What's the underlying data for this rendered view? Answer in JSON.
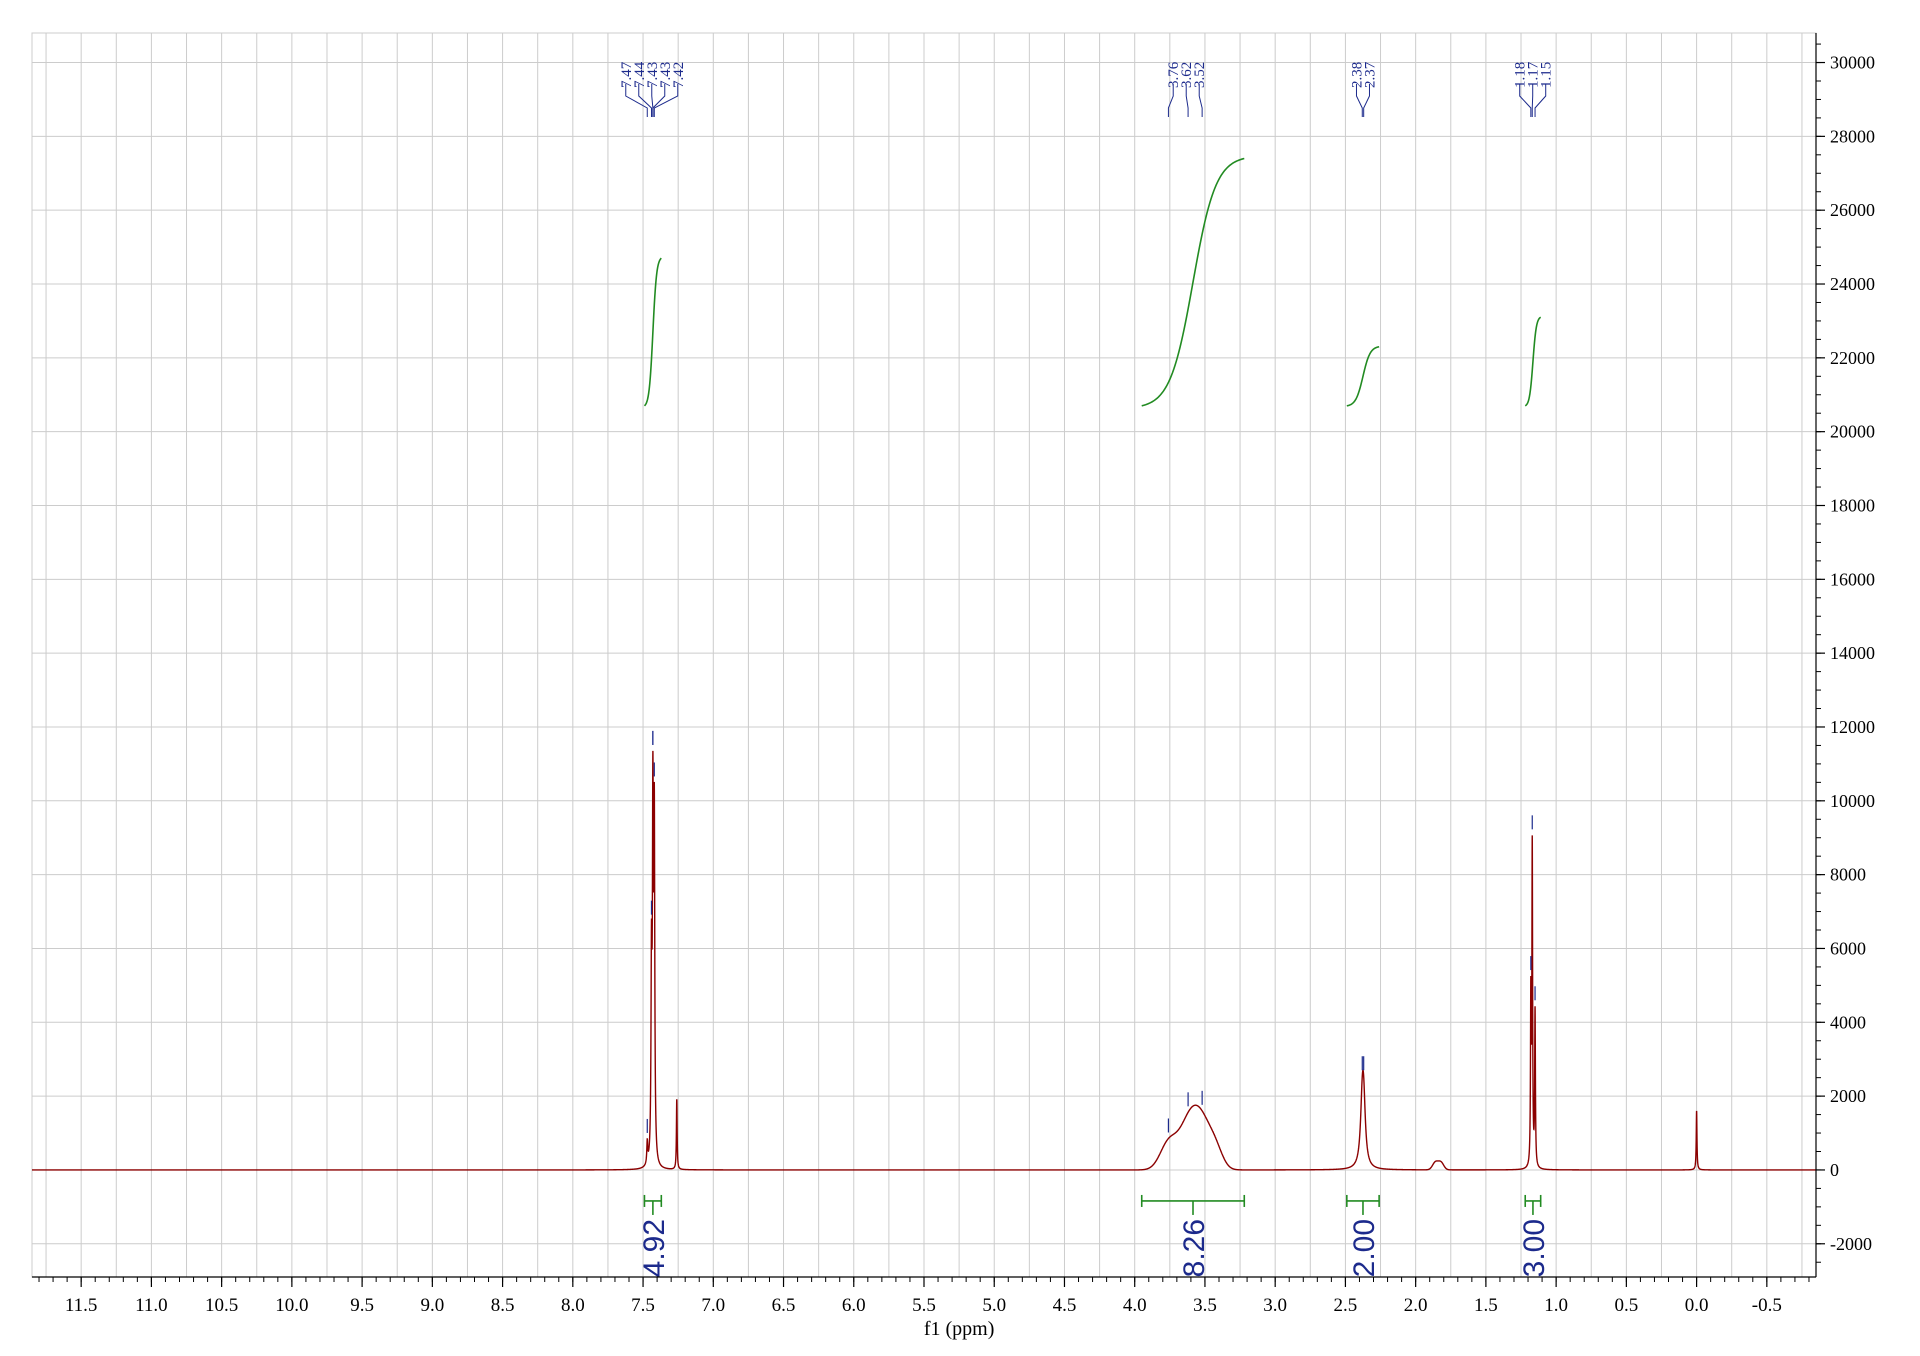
{
  "chart_data": {
    "type": "line",
    "title": "",
    "xlabel": "f1 (ppm)",
    "ylabel": "",
    "x_reversed": true,
    "xlim": [
      11.85,
      -0.85
    ],
    "ylim": [
      -2900,
      30800
    ],
    "grid": true,
    "x_ticks": [
      11.5,
      11.0,
      10.5,
      10.0,
      9.5,
      9.0,
      8.5,
      8.0,
      7.5,
      7.0,
      6.5,
      6.0,
      5.5,
      5.0,
      4.5,
      4.0,
      3.5,
      3.0,
      2.5,
      2.0,
      1.5,
      1.0,
      0.5,
      0.0,
      -0.5
    ],
    "x_tick_labels": [
      "11.5",
      "11.0",
      "10.5",
      "10.0",
      "9.5",
      "9.0",
      "8.5",
      "8.0",
      "7.5",
      "7.0",
      "6.5",
      "6.0",
      "5.5",
      "5.0",
      "4.5",
      "4.0",
      "3.5",
      "3.0",
      "2.5",
      "2.0",
      "1.5",
      "1.0",
      "0.5",
      "0.0",
      "-0.5"
    ],
    "y_ticks": [
      -2000,
      0,
      2000,
      4000,
      6000,
      8000,
      10000,
      12000,
      14000,
      16000,
      18000,
      20000,
      22000,
      24000,
      26000,
      28000,
      30000
    ],
    "y_tick_labels": [
      "-2000",
      "0",
      "2000",
      "4000",
      "6000",
      "8000",
      "10000",
      "12000",
      "14000",
      "16000",
      "18000",
      "20000",
      "22000",
      "24000",
      "26000",
      "28000",
      "30000"
    ],
    "colors": {
      "spectrum": "#8b0000",
      "integral": "#228b22",
      "labels": "#1c2a8c",
      "grid": "#cccccc",
      "axis": "#000000"
    },
    "peaks": [
      {
        "type": "lorentz",
        "x": 7.47,
        "h": 600,
        "w": 0.004
      },
      {
        "type": "lorentz",
        "x": 7.44,
        "h": 5100,
        "w": 0.004
      },
      {
        "type": "lorentz",
        "x": 7.43,
        "h": 9400,
        "w": 0.004
      },
      {
        "type": "lorentz",
        "x": 7.42,
        "h": 9000,
        "w": 0.004
      },
      {
        "type": "lorentz",
        "x": 7.26,
        "h": 1900,
        "w": 0.003
      },
      {
        "type": "gauss",
        "x": 3.76,
        "h": 700,
        "w": 0.06
      },
      {
        "type": "gauss",
        "x": 3.62,
        "h": 1100,
        "w": 0.07
      },
      {
        "type": "gauss",
        "x": 3.52,
        "h": 1150,
        "w": 0.07
      },
      {
        "type": "gauss",
        "x": 3.42,
        "h": 400,
        "w": 0.05
      },
      {
        "type": "lorentz",
        "x": 2.38,
        "h": 1500,
        "w": 0.015
      },
      {
        "type": "lorentz",
        "x": 2.37,
        "h": 1500,
        "w": 0.015
      },
      {
        "type": "gauss",
        "x": 1.86,
        "h": 200,
        "w": 0.02
      },
      {
        "type": "gauss",
        "x": 1.82,
        "h": 200,
        "w": 0.02
      },
      {
        "type": "lorentz",
        "x": 1.18,
        "h": 4500,
        "w": 0.003
      },
      {
        "type": "lorentz",
        "x": 1.17,
        "h": 8600,
        "w": 0.003
      },
      {
        "type": "lorentz",
        "x": 1.15,
        "h": 4200,
        "w": 0.003
      },
      {
        "type": "lorentz",
        "x": 0.0,
        "h": 1600,
        "w": 0.003
      }
    ],
    "peak_label_groups": [
      {
        "labels": [
          "7.47",
          "7.44",
          "7.43",
          "7.43",
          "7.42"
        ],
        "x": [
          7.47,
          7.44,
          7.43,
          7.43,
          7.42
        ]
      },
      {
        "labels": [
          "3.76",
          "3.62",
          "3.52"
        ],
        "x": [
          3.76,
          3.62,
          3.52
        ]
      },
      {
        "labels": [
          "2.38",
          "2.37"
        ],
        "x": [
          2.38,
          2.37
        ]
      },
      {
        "labels": [
          "1.18",
          "1.17",
          "1.15"
        ],
        "x": [
          1.18,
          1.17,
          1.15
        ]
      }
    ],
    "integrals": [
      {
        "label": "4.92",
        "x_start": 7.49,
        "x_end": 7.37,
        "y_start": 20700,
        "y_end": 24700
      },
      {
        "label": "8.26",
        "x_start": 3.95,
        "x_end": 3.22,
        "y_start": 20700,
        "y_end": 27400
      },
      {
        "label": "2.00",
        "x_start": 2.49,
        "x_end": 2.26,
        "y_start": 20700,
        "y_end": 22300
      },
      {
        "label": "3.00",
        "x_start": 1.22,
        "x_end": 1.11,
        "y_start": 20700,
        "y_end": 23100
      }
    ]
  }
}
